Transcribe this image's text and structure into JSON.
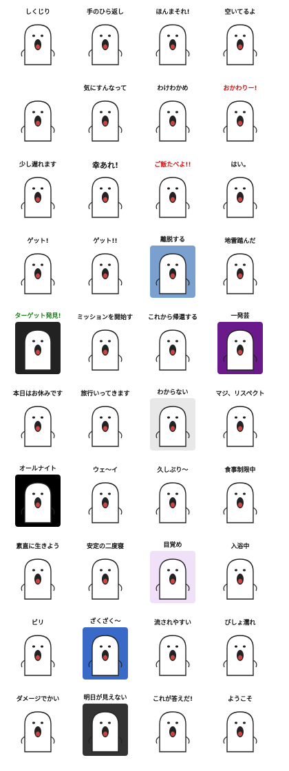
{
  "captions": [
    "しくじり",
    "手のひら返し",
    "ほんまそれ!",
    "空いてるよ",
    "",
    "気にすんなって",
    "わけわかめ",
    "おかわりー!",
    "少し遅れます",
    "幸あれ!",
    "ご飯たべよ!!",
    "はい。",
    "ゲット!",
    "ゲット!!",
    "離脱する",
    "地雷踏んだ",
    "ターゲット発見!",
    "ミッションを開始する",
    "これから帰還する",
    "一発芸",
    "本日はお休みです",
    "旅行いってきます",
    "わからない",
    "マジ、リスペクト",
    "オールナイト",
    "ウェ〜イ",
    "久しぶり〜",
    "食事制限中",
    "素直に生きよう",
    "安定の二度寝",
    "目覚め",
    "入浴中",
    "ビリ",
    "ざくざく〜",
    "流されやすい",
    "びしょ濡れ",
    "ダメージでかい",
    "明日が見えない",
    "これが答えだ!",
    "ようこそ"
  ],
  "colors": {
    "ink": "#111111",
    "red": "#d01010",
    "green": "#1a7a1a",
    "pink": "#e0207a"
  }
}
